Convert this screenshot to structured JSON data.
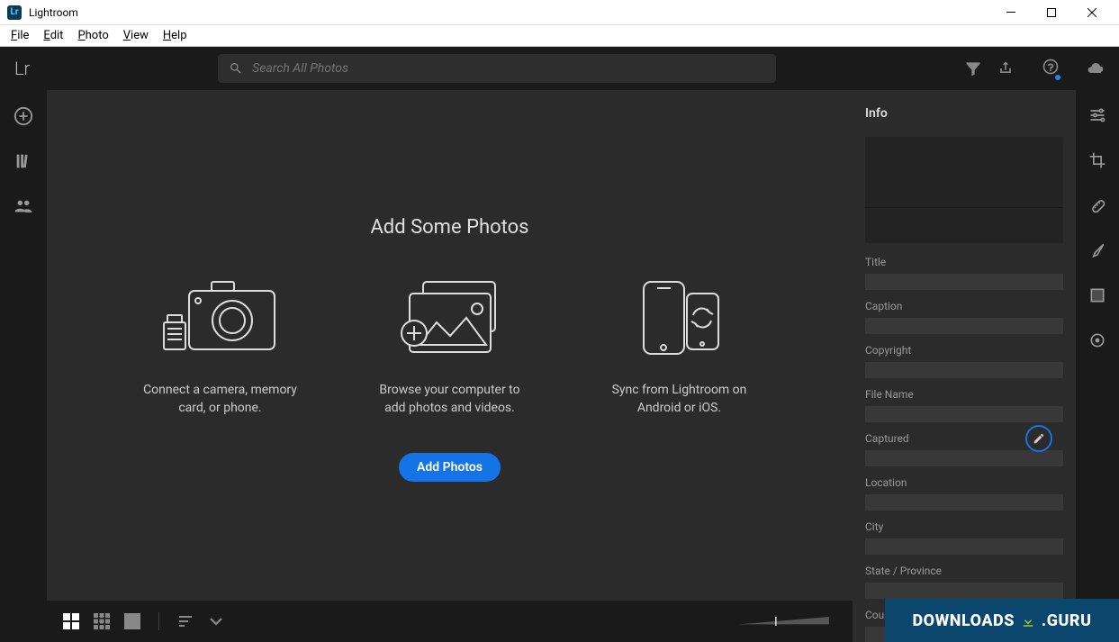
{
  "titlebar": {
    "title": "Lightroom"
  },
  "menubar": [
    "File",
    "Edit",
    "Photo",
    "View",
    "Help"
  ],
  "appbar": {
    "logo": "Lr",
    "search_placeholder": "Search All Photos"
  },
  "center": {
    "heading": "Add Some Photos",
    "cards": [
      {
        "text": "Connect a camera, memory card, or phone."
      },
      {
        "text": "Browse your computer to add photos and videos."
      },
      {
        "text": "Sync from Lightroom on Android or iOS."
      }
    ],
    "add_button": "Add Photos"
  },
  "info": {
    "title": "Info",
    "fields": [
      "Title",
      "Caption",
      "Copyright",
      "File Name",
      "Captured",
      "Location",
      "City",
      "State / Province",
      "Country"
    ]
  },
  "watermark": {
    "left": "DOWNLOADS",
    "right": ".GURU"
  },
  "colors": {
    "accent": "#1473e6",
    "bg_dark": "#1a1a1a",
    "bg_panel": "#2b2b2b"
  }
}
